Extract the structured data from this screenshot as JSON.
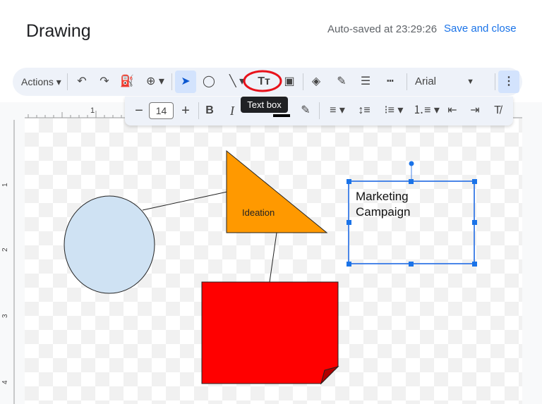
{
  "header": {
    "title": "Drawing",
    "autosave": "Auto-saved at 23:29:26",
    "save_close": "Save and close"
  },
  "toolbar": {
    "actions": "Actions",
    "font": "Arial",
    "tooltip": "Text box",
    "font_size": "14",
    "icons": [
      "undo-icon",
      "redo-icon",
      "paint-format-icon",
      "zoom-icon",
      "select-icon",
      "shape-icon",
      "line-icon",
      "text-box-icon",
      "image-icon",
      "fill-color-icon",
      "border-color-icon",
      "border-weight-icon",
      "border-dash-icon",
      "more-icon"
    ]
  },
  "format_toolbar": {
    "icons": [
      "decrease-font-icon",
      "increase-font-icon",
      "bold-icon",
      "italic-icon",
      "text-color-icon",
      "highlight-icon",
      "align-icon",
      "line-spacing-icon",
      "bullet-list-icon",
      "numbered-list-icon",
      "decrease-indent-icon",
      "increase-indent-icon",
      "clear-formatting-icon"
    ]
  },
  "ruler": {
    "top": [
      "1"
    ],
    "left": [
      "1",
      "2",
      "3",
      "4"
    ]
  },
  "shapes": {
    "triangle_label": "Ideation",
    "textbox_line1": "Marketing",
    "textbox_line2": "Campaign"
  },
  "colors": {
    "accent": "#1a73e8",
    "circle": "#cfe2f3",
    "triangle": "#ff9900",
    "rectangle": "#ff0000",
    "highlight": "#e8121b"
  }
}
